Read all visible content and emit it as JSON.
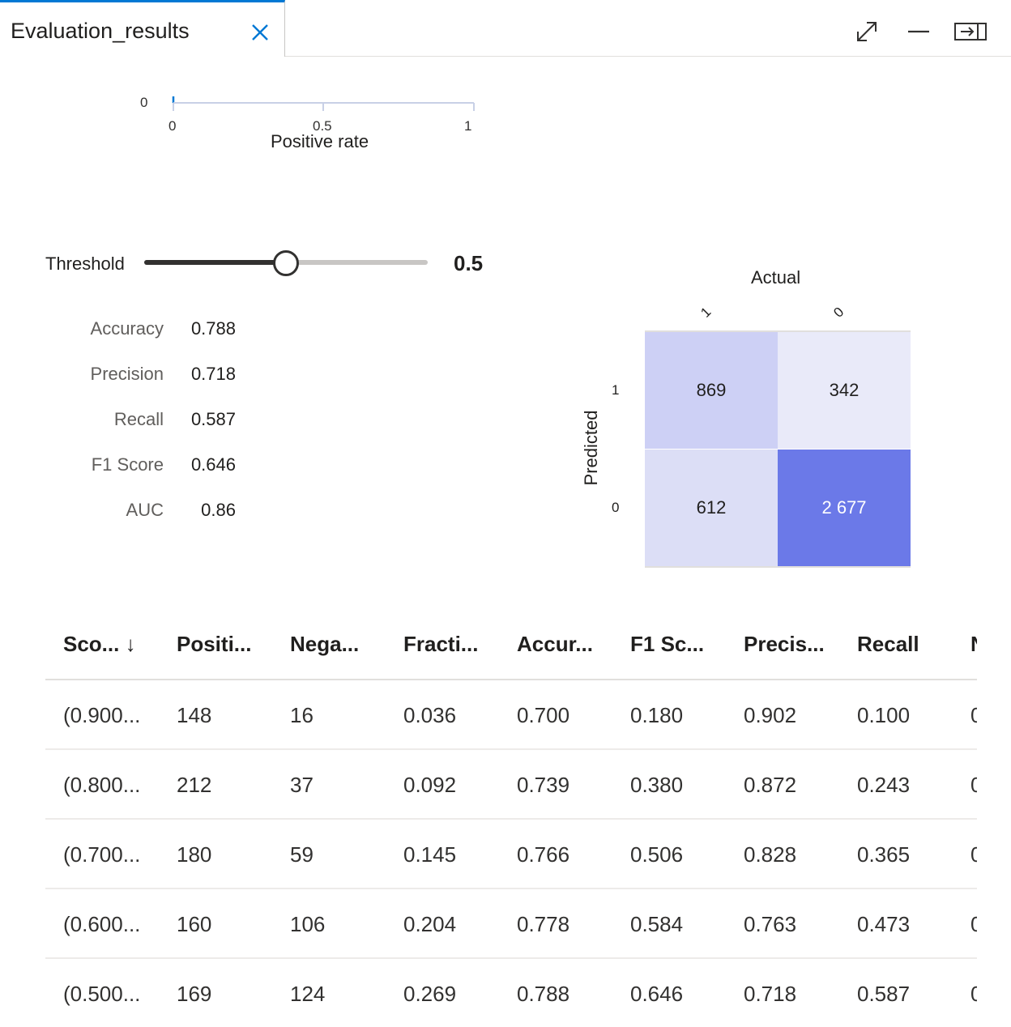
{
  "tab": {
    "title": "Evaluation_results"
  },
  "roc": {
    "y_tick": "0",
    "x_ticks": [
      "0",
      "0.5",
      "1"
    ],
    "xlabel": "Positive rate"
  },
  "threshold": {
    "label": "Threshold",
    "value": "0.5",
    "fraction": 0.5
  },
  "metrics": [
    {
      "label": "Accuracy",
      "value": "0.788"
    },
    {
      "label": "Precision",
      "value": "0.718"
    },
    {
      "label": "Recall",
      "value": "0.587"
    },
    {
      "label": "F1 Score",
      "value": "0.646"
    },
    {
      "label": "AUC",
      "value": "0.86"
    }
  ],
  "confusion": {
    "actual_label": "Actual",
    "predicted_label": "Predicted",
    "col_labels": [
      "1",
      "0"
    ],
    "row_labels": [
      "1",
      "0"
    ],
    "cells": [
      [
        "869",
        "342"
      ],
      [
        "612",
        "2 677"
      ]
    ],
    "colors": [
      [
        "#cdd0f5",
        "#e9eaf9"
      ],
      [
        "#dcdef6",
        "#6b79e8"
      ]
    ],
    "text_colors": [
      [
        "#201f1e",
        "#201f1e"
      ],
      [
        "#201f1e",
        "#ffffff"
      ]
    ]
  },
  "table": {
    "headers": [
      "Sco... ↓",
      "Positi...",
      "Nega...",
      "Fracti...",
      "Accur...",
      "F1 Sc...",
      "Precis...",
      "Recall",
      "N"
    ],
    "rows": [
      [
        "(0.900...",
        "148",
        "16",
        "0.036",
        "0.700",
        "0.180",
        "0.902",
        "0.100",
        "0"
      ],
      [
        "(0.800...",
        "212",
        "37",
        "0.092",
        "0.739",
        "0.380",
        "0.872",
        "0.243",
        "0"
      ],
      [
        "(0.700...",
        "180",
        "59",
        "0.145",
        "0.766",
        "0.506",
        "0.828",
        "0.365",
        "0"
      ],
      [
        "(0.600...",
        "160",
        "106",
        "0.204",
        "0.778",
        "0.584",
        "0.763",
        "0.473",
        "0"
      ],
      [
        "(0.500...",
        "169",
        "124",
        "0.269",
        "0.788",
        "0.646",
        "0.718",
        "0.587",
        "0"
      ]
    ]
  }
}
